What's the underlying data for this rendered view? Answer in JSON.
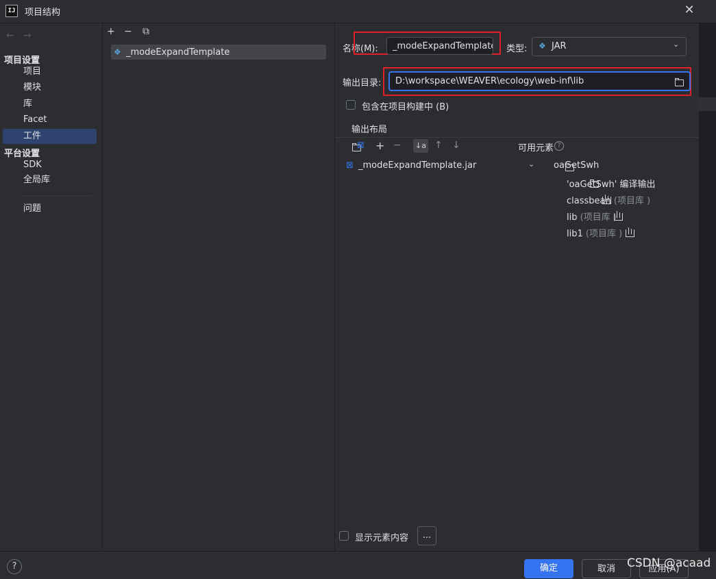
{
  "window": {
    "title": "项目结构",
    "app_icon_text": "IJ"
  },
  "nav": {
    "back": "←",
    "forward": "→"
  },
  "sidebar": {
    "project_settings_title": "项目设置",
    "project_items": [
      "项目",
      "模块",
      "库",
      "Facet",
      "工件"
    ],
    "selected": "工件",
    "platform_settings_title": "平台设置",
    "platform_items": [
      "SDK",
      "全局库"
    ],
    "problems": "问题"
  },
  "artifact_list": {
    "toolbar": {
      "add": "+",
      "remove": "−",
      "copy": "⧉"
    },
    "items": [
      {
        "name": "_modeExpandTemplate"
      }
    ]
  },
  "form": {
    "name_label": "名称(M):",
    "name_value": "_modeExpandTemplate",
    "type_label": "类型:",
    "type_value": "JAR",
    "output_label": "输出目录:",
    "output_value": "D:\\workspace\\WEAVER\\ecology\\web-inf\\lib",
    "include_in_build_label": "包含在项目构建中 (B)",
    "output_layout_tab": "输出布局"
  },
  "layout": {
    "root_item": "_modeExpandTemplate.jar",
    "available_label": "可用元素",
    "tree": {
      "module": "oaGetSwh",
      "children": [
        {
          "name": "'oaGetSwh' 编译输出",
          "suffix": ""
        },
        {
          "name": "classbean",
          "suffix": "(项目库 )"
        },
        {
          "name": "lib",
          "suffix": "(项目库 )"
        },
        {
          "name": "lib1",
          "suffix": "(项目库 )"
        }
      ]
    },
    "show_contents_label": "显示元素内容",
    "more_button": "..."
  },
  "footer": {
    "help": "?",
    "ok": "确定",
    "cancel": "取消",
    "apply": "应用(A)"
  },
  "watermark": "CSDN @acaad",
  "colors": {
    "accent": "#3574f0",
    "highlight_border": "#e0202a",
    "selection": "#2e436e"
  }
}
